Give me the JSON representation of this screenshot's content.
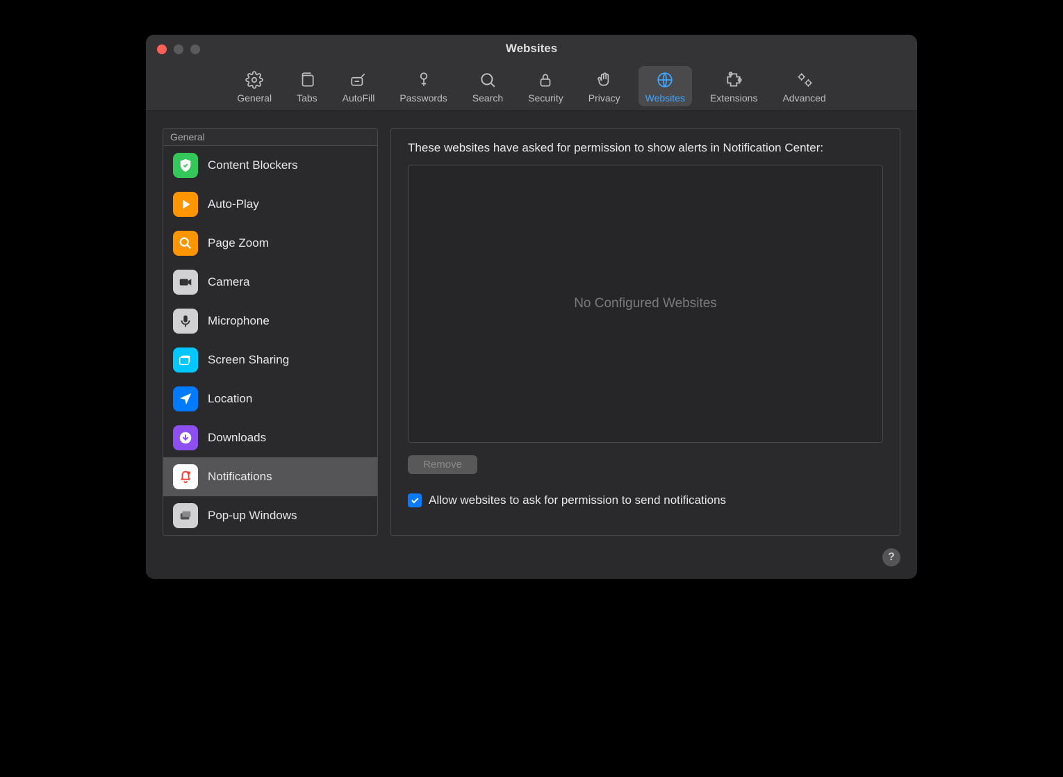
{
  "window": {
    "title": "Websites"
  },
  "toolbar": {
    "tabs": [
      {
        "id": "general",
        "label": "General"
      },
      {
        "id": "tabs",
        "label": "Tabs"
      },
      {
        "id": "autofill",
        "label": "AutoFill"
      },
      {
        "id": "passwords",
        "label": "Passwords"
      },
      {
        "id": "search",
        "label": "Search"
      },
      {
        "id": "security",
        "label": "Security"
      },
      {
        "id": "privacy",
        "label": "Privacy"
      },
      {
        "id": "websites",
        "label": "Websites",
        "active": true
      },
      {
        "id": "extensions",
        "label": "Extensions"
      },
      {
        "id": "advanced",
        "label": "Advanced"
      }
    ]
  },
  "sidebar": {
    "header": "General",
    "items": [
      {
        "id": "content-blockers",
        "label": "Content Blockers",
        "icon": "shield-check-icon",
        "color": "#34c759"
      },
      {
        "id": "auto-play",
        "label": "Auto-Play",
        "icon": "play-icon",
        "color": "#ff9500"
      },
      {
        "id": "page-zoom",
        "label": "Page Zoom",
        "icon": "zoom-icon",
        "color": "#ff9500"
      },
      {
        "id": "camera",
        "label": "Camera",
        "icon": "camera-icon",
        "color": "#d1d1d3"
      },
      {
        "id": "microphone",
        "label": "Microphone",
        "icon": "microphone-icon",
        "color": "#d1d1d3"
      },
      {
        "id": "screen-sharing",
        "label": "Screen Sharing",
        "icon": "screen-sharing-icon",
        "color": "#00c7ff"
      },
      {
        "id": "location",
        "label": "Location",
        "icon": "location-icon",
        "color": "#007aff"
      },
      {
        "id": "downloads",
        "label": "Downloads",
        "icon": "download-icon",
        "color": "#8e4ff0"
      },
      {
        "id": "notifications",
        "label": "Notifications",
        "icon": "bell-icon",
        "color": "#ffffff",
        "selected": true
      },
      {
        "id": "popups",
        "label": "Pop-up Windows",
        "icon": "popup-icon",
        "color": "#d1d1d3"
      }
    ]
  },
  "main": {
    "description": "These websites have asked for permission to show alerts in Notification Center:",
    "empty_text": "No Configured Websites",
    "remove_label": "Remove",
    "checkbox_label": "Allow websites to ask for permission to send notifications",
    "checkbox_checked": true
  },
  "footer": {
    "help_label": "?"
  }
}
